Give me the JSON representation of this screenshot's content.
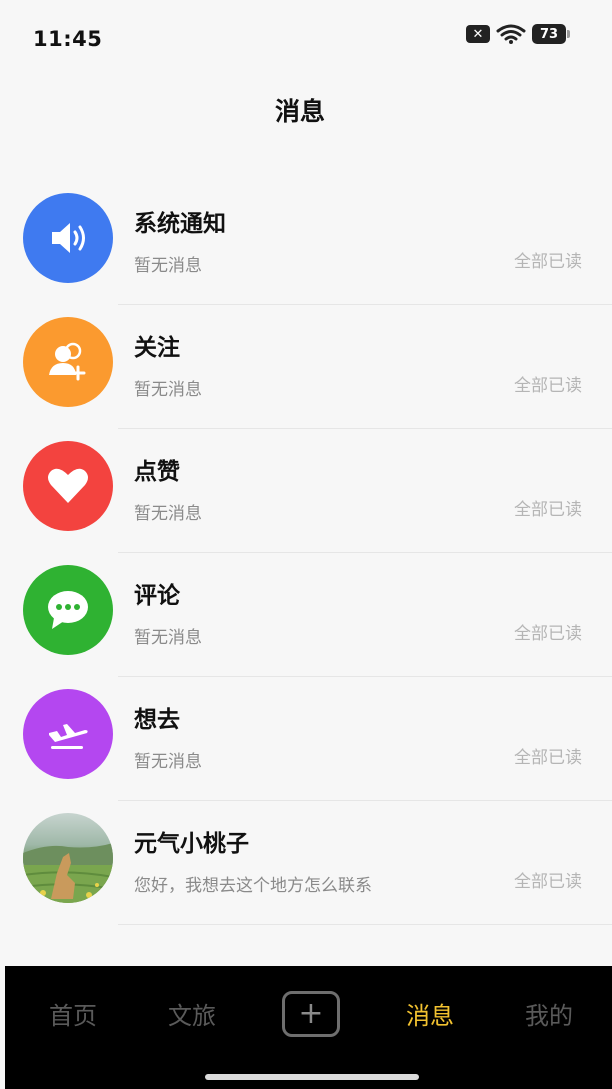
{
  "status_bar": {
    "time": "11:45",
    "battery": "73"
  },
  "header": {
    "title": "消息"
  },
  "messages": [
    {
      "name": "系统通知",
      "preview": "暂无消息",
      "action": "全部已读",
      "icon": "speaker-icon",
      "color": "#3f7af0"
    },
    {
      "name": "关注",
      "preview": "暂无消息",
      "action": "全部已读",
      "icon": "add-user-icon",
      "color": "#fb9a2f"
    },
    {
      "name": "点赞",
      "preview": "暂无消息",
      "action": "全部已读",
      "icon": "heart-icon",
      "color": "#f3433f"
    },
    {
      "name": "评论",
      "preview": "暂无消息",
      "action": "全部已读",
      "icon": "comment-icon",
      "color": "#2fb232"
    },
    {
      "name": "想去",
      "preview": "暂无消息",
      "action": "全部已读",
      "icon": "airplane-icon",
      "color": "#b447f0"
    },
    {
      "name": "元气小桃子",
      "preview": "您好，我想去这个地方怎么联系",
      "action": "全部已读",
      "icon": "user-photo",
      "color": "#7a9a6a"
    }
  ],
  "tab_bar": {
    "tabs": [
      {
        "label": "首页"
      },
      {
        "label": "文旅"
      },
      {
        "label": "消息"
      },
      {
        "label": "我的"
      }
    ],
    "publish_icon": "plus-icon",
    "active_color": "#f2c230"
  }
}
